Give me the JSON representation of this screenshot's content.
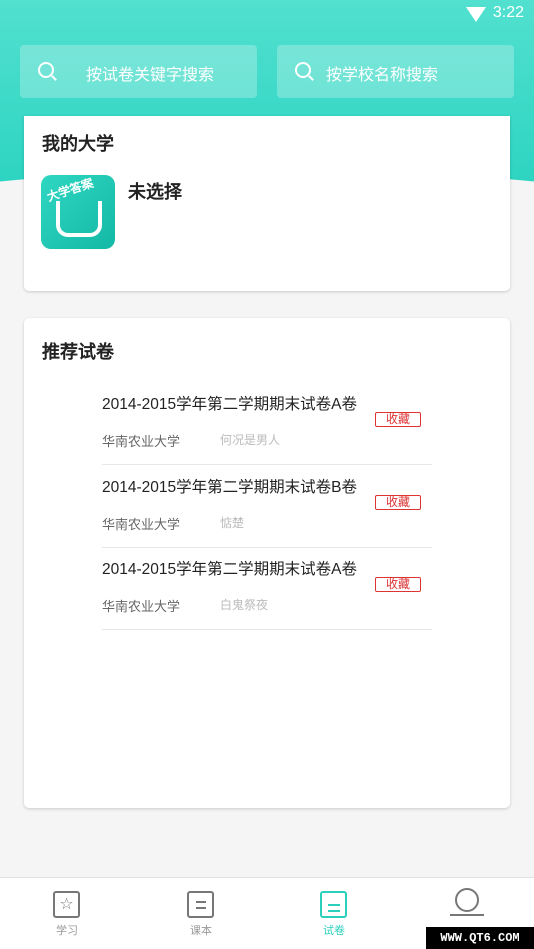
{
  "status_bar": {
    "time": "3:22",
    "wifi_icon": "wifi-icon"
  },
  "search": {
    "paper_placeholder": "按试卷关键字搜索",
    "school_placeholder": "按学校名称搜索",
    "icon": "search-icon"
  },
  "my_university": {
    "title": "我的大学",
    "selected": "未选择",
    "logo_text": "大学答案"
  },
  "recommended": {
    "title": "推荐试卷",
    "items": [
      {
        "name": "2014-2015学年第二学期期末试卷A卷",
        "school": "华南农业大学",
        "author": "何况是男人",
        "fav_label": "收藏"
      },
      {
        "name": "2014-2015学年第二学期期末试卷B卷",
        "school": "华南农业大学",
        "author": "惦楚",
        "fav_label": "收藏"
      },
      {
        "name": "2014-2015学年第二学期期末试卷A卷",
        "school": "华南农业大学",
        "author": "白鬼祭夜",
        "fav_label": "收藏"
      }
    ]
  },
  "tabs": [
    {
      "label": "学习",
      "icon": "star-icon",
      "active": false
    },
    {
      "label": "课本",
      "icon": "book-icon",
      "active": false
    },
    {
      "label": "试卷",
      "icon": "paper-icon",
      "active": true
    },
    {
      "label": "",
      "icon": "profile-icon",
      "active": false
    }
  ],
  "colors": {
    "accent": "#2bd0bd",
    "header_top": "#52e0cf",
    "header_bottom": "#21d0bd",
    "favorite": "#dd3333"
  },
  "watermark": "WWW.QT6.COM"
}
